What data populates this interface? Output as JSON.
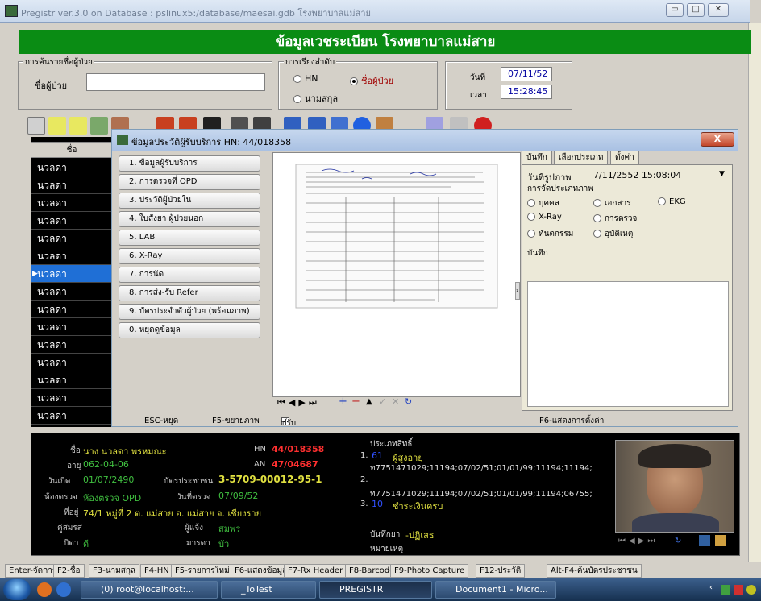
{
  "window": {
    "title": "Pregistr ver.3.0 on  Database : pslinux5:/database/maesai.gdb   โรงพยาบาลแม่สาย"
  },
  "banner": {
    "text": "ข้อมูลเวชระเบียน โรงพยาบาลแม่สาย"
  },
  "search_group": {
    "caption": "การค้นรายชื่อผู้ป่วย",
    "label": "ชื่อผู้ป่วย",
    "value": ""
  },
  "sort_group": {
    "caption": "การเรียงลำดับ",
    "opt_hn": "HN",
    "opt_name": "ชื่อผู้ป่วย",
    "opt_surname": "นามสกุล"
  },
  "datetime": {
    "date_label": "วันที่",
    "date_value": "07/11/52",
    "time_label": "เวลา",
    "time_value": "15:28:45"
  },
  "list": {
    "header": "ชื่อ",
    "rows": [
      "นวลดา",
      "นวลดา",
      "นวลดา",
      "นวลดา",
      "นวลดา",
      "นวลดา",
      "นวลดา",
      "นวลดา",
      "นวลดา",
      "นวลดา",
      "นวลดา",
      "นวลดา",
      "นวลดา",
      "นวลดา",
      "นวลดา"
    ]
  },
  "dialog": {
    "title": "ข้อมูลประวัติผู้รับบริการ  HN: 44/018358",
    "close": "X",
    "menu": [
      "1. ข้อมูลผู้รับบริการ",
      "2. การตรวจที่ OPD",
      "3. ประวัติผู้ป่วยใน",
      "4. ใบสั่งยา ผู้ป่วยนอก",
      "5. LAB",
      "6. X-Ray",
      "7. การนัด",
      "8. การส่ง-รับ Refer",
      "9. บัตรประจำตัวผู้ป่วย (พร้อมภาพ)",
      "0. หยุดดูข้อมูล"
    ],
    "tabs": [
      "บันทึก",
      "เลือกประเภท",
      "ตั้งค่า"
    ],
    "image_date_label": "วันที่รูปภาพ",
    "image_date_value": "7/11/2552 15:08:04",
    "category_label": "การจัดประเภทภาพ",
    "categories": [
      "บุคคล",
      "เอกสาร",
      "EKG",
      "X-Ray",
      "การตรวจ",
      "ทันตกรรม",
      "อุบัติเหตุ"
    ],
    "note_label": "บันทึก",
    "status_left": "ESC-หยุด",
    "status_mid": "F5-ขยายภาพ",
    "status_check": "ปรับภาพให้พอดี",
    "status_right": "F6-แสดงการตั้งค่า"
  },
  "patient": {
    "name_label": "ชื่อ",
    "name_value": "นาง นวลดา  พรหมณะ",
    "hn_label": "HN",
    "hn_value": "44/018358",
    "age_label": "อายุ",
    "age_value": "062-04-06",
    "an_label": "AN",
    "an_value": "47/04687",
    "birth_label": "วันเกิด",
    "birth_value": "01/07/2490",
    "id_label": "บัตรประชาชน",
    "id_value": "3-5709-00012-95-1",
    "room_label": "ห้องตรวจ",
    "room_value": "ห้องตรวจ OPD",
    "visit_label": "วันที่ตรวจ",
    "visit_value": "07/09/52",
    "addr_label": "ที่อยู่",
    "addr_value": "74/1 หมู่ที่ 2 ต. แม่สาย อ. แม่สาย จ. เชียงราย",
    "spouse_label": "คู่สมรส",
    "spouse_value": "",
    "informant_label": "ผู้แจ้ง",
    "informant_value": "สมพร",
    "father_label": "บิดา",
    "father_value": "ดี",
    "mother_label": "มารดา",
    "mother_value": "บัว",
    "rights_label": "ประเภทสิทธิ์",
    "rights": [
      {
        "num": "1.",
        "code": "61",
        "name": "ผู้สูงอายุ",
        "detail": "ท7751471029;11194;07/02/51;01/01/99;11194;11194;"
      },
      {
        "num": "2.",
        "code": "",
        "name": "",
        "detail": "ท7751471029;11194;07/02/51;01/01/99;11194;06755;"
      },
      {
        "num": "3.",
        "code": "10",
        "name": "ชำระเงินครบ",
        "detail": ""
      }
    ],
    "drug_allergy_label": "บันทึกยา",
    "drug_allergy_value": "-ปฏิเสธ",
    "remark_label": "หมายเหตุ"
  },
  "fkeys": [
    "Enter-จัดการ",
    "F2-ชื่อ",
    "F3-นามสกุล",
    "F4-HN",
    "F5-รายการใหม่",
    "F6-แสดงข้อมูล",
    "F7-Rx Header",
    "F8-Barcode",
    "F9-Photo Capture",
    "F12-ประวัติ",
    "Alt-F4-ค้นบัตรประชาชน"
  ],
  "taskbar": {
    "items": [
      "(0) root@localhost:...",
      "_ToTest",
      "PREGISTR",
      "Document1 - Micro..."
    ]
  }
}
